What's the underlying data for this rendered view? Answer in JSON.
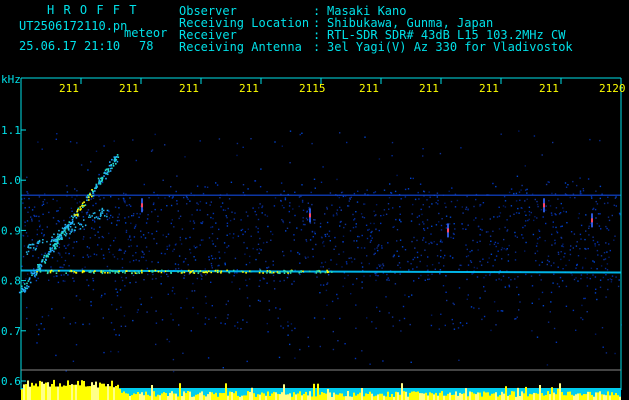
{
  "header": {
    "logo": "H R O F F T",
    "filename": "UT2506172110.pn",
    "tag": "meteor",
    "datetime": "25.06.17 21:10",
    "count": "78",
    "fields": [
      {
        "label": "Observer",
        "sep": ":",
        "value": "Masaki Kano"
      },
      {
        "label": "Receiving Location",
        "sep": ":",
        "value": "Shibukawa, Gunma, Japan"
      },
      {
        "label": "Receiver",
        "sep": ":",
        "value": "RTL-SDR SDR# 43dB L15 103.2MHz CW"
      },
      {
        "label": "Receiving Antenna",
        "sep": ":",
        "value": "3el Yagi(V) Az 330 for Vladivostok"
      }
    ]
  },
  "colors": {
    "axis": "#00e0e8",
    "time_labels": "#ffff00",
    "signal_high": "#ffff00",
    "signal_mid": "#00c8ff",
    "background": "#000000"
  },
  "chart_data": {
    "type": "heatmap",
    "ylabel": "kHz",
    "y_ticks": [
      "1.1",
      "1.0",
      "0.9",
      "0.8",
      "0.7",
      "0.6"
    ],
    "y_tick_values": [
      1.1,
      1.0,
      0.9,
      0.8,
      0.7,
      0.6
    ],
    "ylim": [
      0.6,
      1.2
    ],
    "x_ticks": [
      "211",
      "211",
      "211",
      "211",
      "2115",
      "211",
      "211",
      "211",
      "211",
      "2120"
    ],
    "x_tick_values": [
      2111,
      2112,
      2113,
      2114,
      2115,
      2116,
      2117,
      2118,
      2119,
      2120
    ],
    "xlim": [
      2110,
      2120
    ],
    "features": {
      "carrier_khz": 0.82,
      "faint_band_khz": 0.97,
      "meteor_head_echo": {
        "start_time": 2110.0,
        "start_khz": 0.78,
        "end_time": 2111.6,
        "end_khz": 1.05
      },
      "vertical_pings": [
        {
          "time": 2112.0,
          "khz": 0.95
        },
        {
          "time": 2114.8,
          "khz": 0.93
        },
        {
          "time": 2117.1,
          "khz": 0.9
        },
        {
          "time": 2118.7,
          "khz": 0.95
        },
        {
          "time": 2119.5,
          "khz": 0.92
        }
      ]
    }
  }
}
